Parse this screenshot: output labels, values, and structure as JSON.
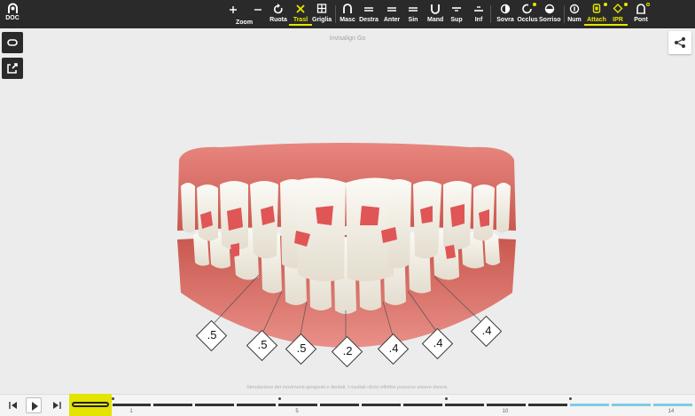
{
  "toolbar": {
    "doc_label": "DOC",
    "zoom_label": "Zoom",
    "tools": [
      {
        "label": "Ruota",
        "icon": "rotate-icon"
      },
      {
        "label": "Trasl",
        "icon": "move-icon"
      },
      {
        "label": "Griglia",
        "icon": "grid-icon"
      },
      {
        "label": "Masc",
        "icon": "maxillary-view-icon"
      },
      {
        "label": "Destra",
        "icon": "right-view-icon"
      },
      {
        "label": "Anter",
        "icon": "anterior-view-icon"
      },
      {
        "label": "Sin",
        "icon": "left-view-icon"
      },
      {
        "label": "Mand",
        "icon": "mandibular-view-icon"
      },
      {
        "label": "Sup",
        "icon": "upper-arch-icon"
      },
      {
        "label": "Inf",
        "icon": "lower-arch-icon"
      },
      {
        "label": "Sovra",
        "icon": "superimpose-icon"
      },
      {
        "label": "Occlus",
        "icon": "occlusion-icon"
      },
      {
        "label": "Sorriso",
        "icon": "smile-icon"
      },
      {
        "label": "Num",
        "icon": "numbering-icon"
      },
      {
        "label": "Attach",
        "icon": "attachment-icon"
      },
      {
        "label": "IPR",
        "icon": "ipr-icon"
      },
      {
        "label": "Pont",
        "icon": "pontic-icon"
      }
    ],
    "active": [
      "Trasl",
      "Attach",
      "IPR"
    ],
    "accent_color": "#e6e600"
  },
  "case_title": "Invisalign Go",
  "ipr_values": [
    ".5",
    ".5",
    ".5",
    ".2",
    ".4",
    ".4",
    ".4"
  ],
  "disclaimer": "Simulazione dei movimenti gengivali e dentali. I risultati clinici effettivi possono essere diversi.",
  "timeline": {
    "current_stage": 0,
    "total_stages": 14,
    "labels": [
      "1",
      "5",
      "10",
      "14"
    ]
  }
}
